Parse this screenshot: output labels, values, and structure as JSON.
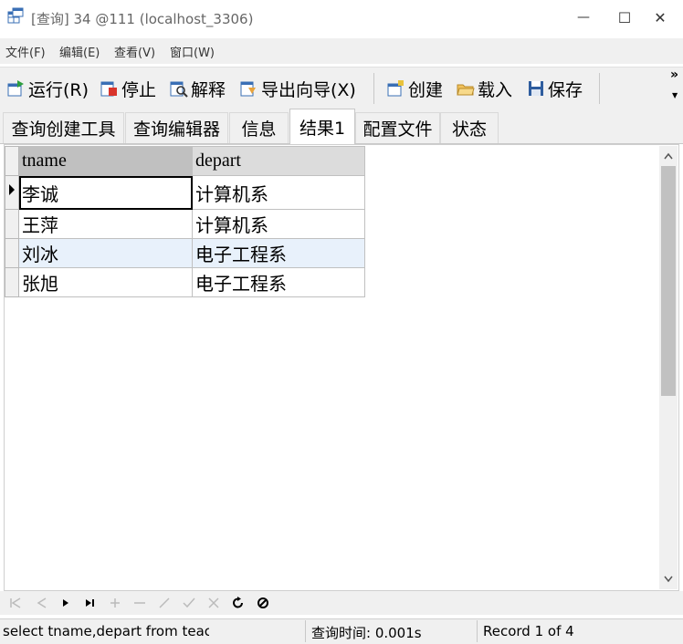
{
  "window": {
    "title": "[查询] 34 @111 (localhost_3306)",
    "controls": {
      "minimize": "—",
      "maximize": "☐",
      "close": "✕"
    }
  },
  "menu": {
    "items": [
      "文件(F)",
      "编辑(E)",
      "查看(V)",
      "窗口(W)"
    ]
  },
  "toolbar": {
    "run": "运行(R)",
    "stop": "停止",
    "explain": "解释",
    "export": "导出向导(X)",
    "create": "创建",
    "load": "载入",
    "save": "保存",
    "overflow": "»"
  },
  "tabs": [
    {
      "label": "查询创建工具"
    },
    {
      "label": "查询编辑器"
    },
    {
      "label": "信息"
    },
    {
      "label": "结果1",
      "active": true
    },
    {
      "label": "配置文件"
    },
    {
      "label": "状态"
    }
  ],
  "grid": {
    "columns": [
      "tname",
      "depart"
    ],
    "rows": [
      [
        "李诚",
        "计算机系"
      ],
      [
        "王萍",
        "计算机系"
      ],
      [
        "刘冰",
        "电子工程系"
      ],
      [
        "张旭",
        "电子工程系"
      ]
    ],
    "current_row": 0,
    "highlighted_row": 2
  },
  "statusbar": {
    "sql": "select tname,depart from teach",
    "query_time": "查询时间: 0.001s",
    "record": "Record 1 of 4"
  },
  "colors": {
    "chrome": "#f0f0f0",
    "header": "#c0c0c0",
    "row_highlight": "#e8f1fb",
    "icon_blue": "#3a6fb5",
    "icon_red": "#d9342b",
    "icon_orange": "#e8a33c"
  }
}
